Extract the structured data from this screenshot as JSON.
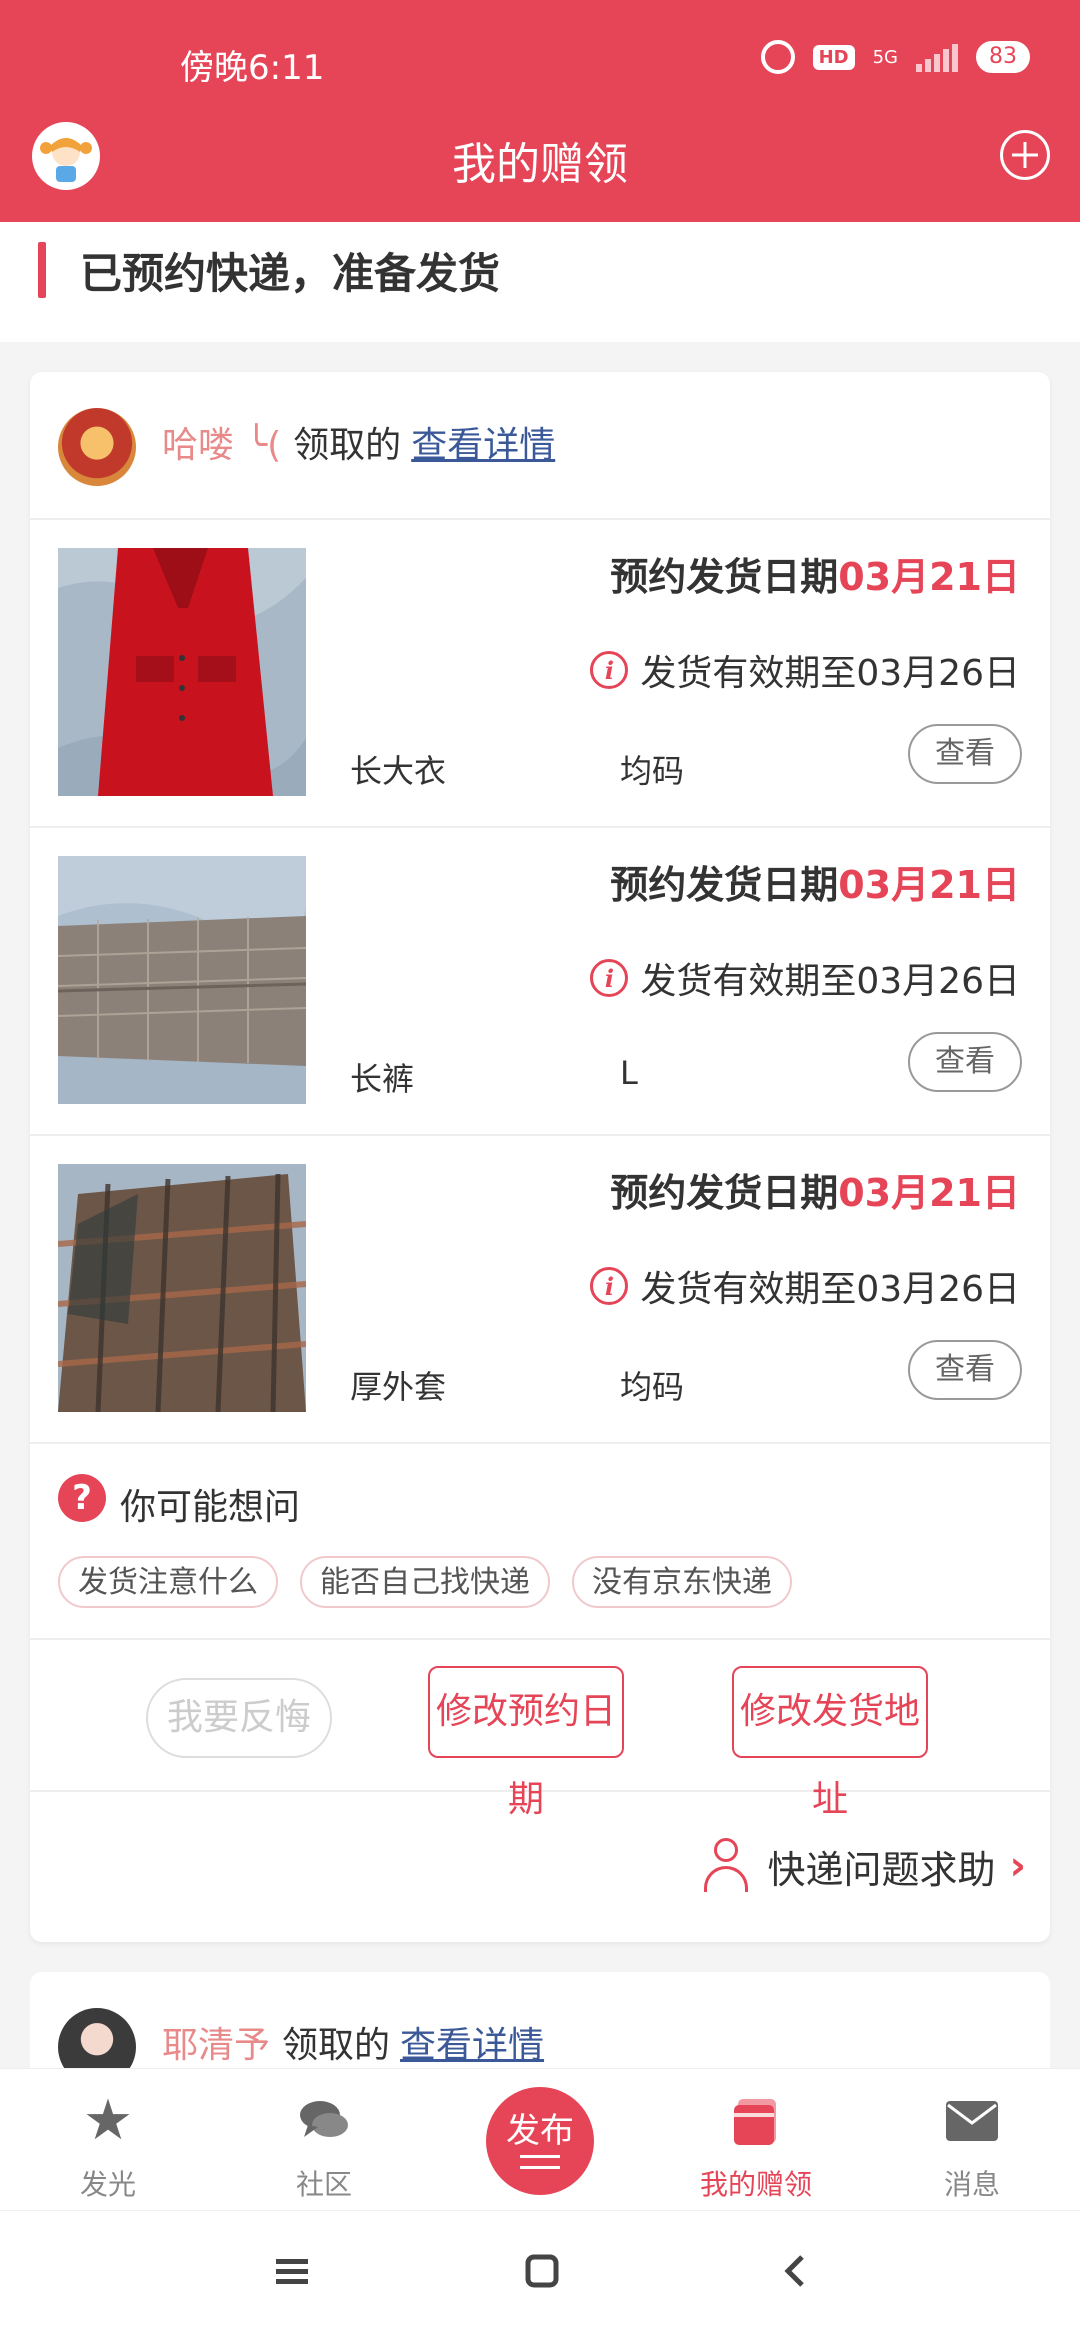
{
  "status_bar": {
    "time": "傍晚6:11",
    "network": "5G",
    "hd": "HD",
    "battery": "83"
  },
  "header": {
    "title": "我的赠领"
  },
  "section": {
    "title": "已预约快递，准备发货"
  },
  "card": {
    "username": "哈喽 ╰(",
    "receive_text": "领取的",
    "detail_link": "查看详情",
    "items": [
      {
        "date_label": "预约发货日期",
        "date_value": "03月21日",
        "valid_text": "发货有效期至03月26日",
        "name": "长大衣",
        "size": "均码",
        "view_label": "查看"
      },
      {
        "date_label": "预约发货日期",
        "date_value": "03月21日",
        "valid_text": "发货有效期至03月26日",
        "name": "长裤",
        "size": "L",
        "view_label": "查看"
      },
      {
        "date_label": "预约发货日期",
        "date_value": "03月21日",
        "valid_text": "发货有效期至03月26日",
        "name": "厚外套",
        "size": "均码",
        "view_label": "查看"
      }
    ],
    "faq": {
      "title": "你可能想问",
      "chips": [
        "发货注意什么",
        "能否自己找快递",
        "没有京东快递"
      ]
    },
    "actions": {
      "regret": "我要反悔",
      "change_date": "修改预约日期",
      "change_address": "修改发货地址"
    },
    "help": {
      "label": "快递问题求助"
    }
  },
  "card2": {
    "username": "耶清予",
    "receive_text": "领取的",
    "detail_link": "查看详情"
  },
  "bottom_nav": {
    "tabs": [
      "发光",
      "社区",
      "发布",
      "我的赠领",
      "消息"
    ],
    "active": "我的赠领"
  },
  "colors": {
    "brand": "#e54557",
    "username": "#e88a8a",
    "link": "#3b5998"
  },
  "icons": [
    "alarm-icon",
    "hd-icon",
    "signal-icon",
    "battery-icon",
    "add-icon",
    "info-icon",
    "question-icon",
    "person-icon",
    "chevron-right-icon",
    "star-icon",
    "chat-icon",
    "gift-icon",
    "mail-icon",
    "menu-icon",
    "home-icon",
    "back-icon"
  ]
}
